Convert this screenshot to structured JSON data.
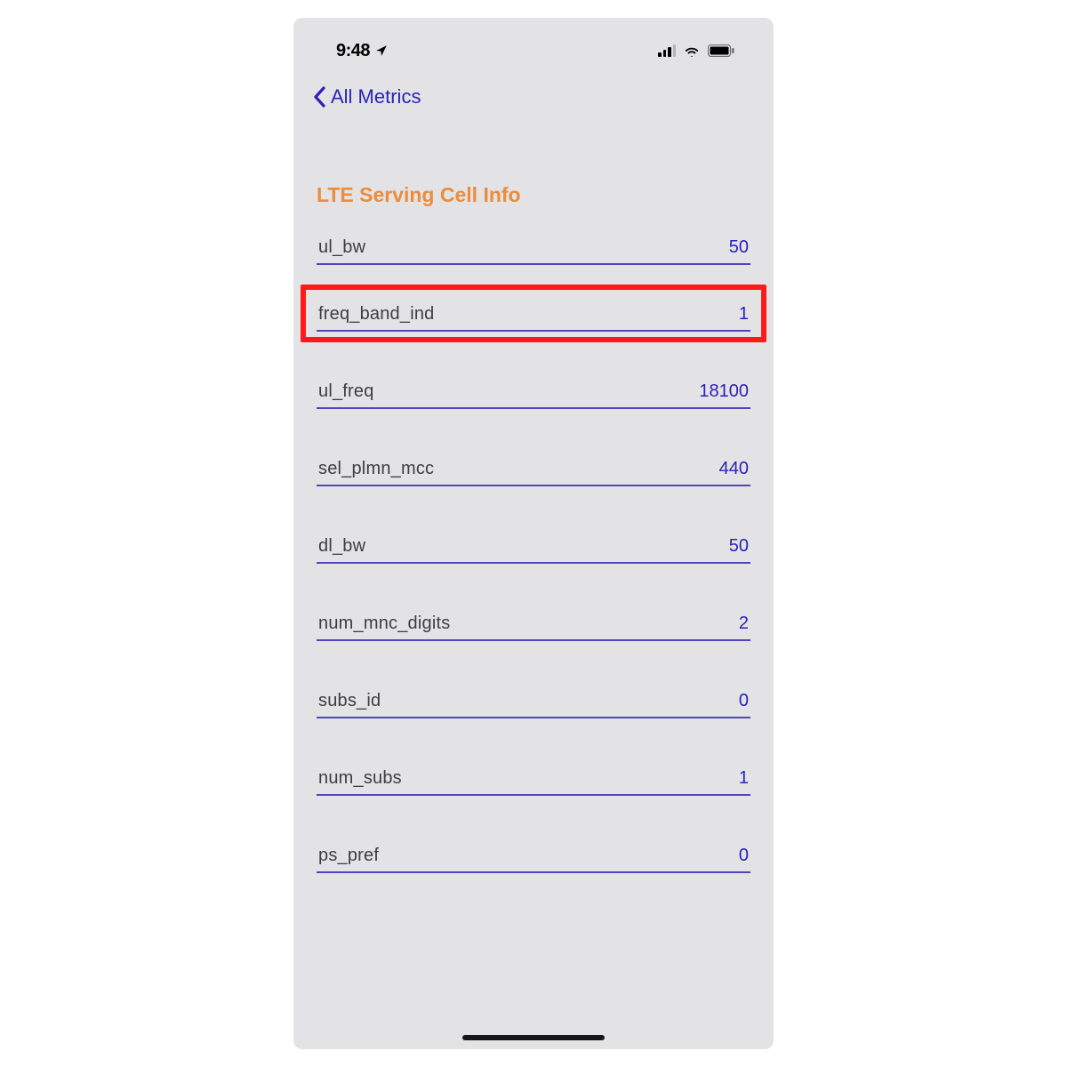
{
  "status": {
    "time": "9:48",
    "location_arrow": true
  },
  "nav": {
    "back_label": "All Metrics"
  },
  "section": {
    "title": "LTE Serving Cell Info"
  },
  "metrics": [
    {
      "label": "ul_bw",
      "value": "50",
      "highlighted": false
    },
    {
      "label": "freq_band_ind",
      "value": "1",
      "highlighted": true
    },
    {
      "label": "ul_freq",
      "value": "18100",
      "highlighted": false
    },
    {
      "label": "sel_plmn_mcc",
      "value": "440",
      "highlighted": false
    },
    {
      "label": "dl_bw",
      "value": "50",
      "highlighted": false
    },
    {
      "label": "num_mnc_digits",
      "value": "2",
      "highlighted": false
    },
    {
      "label": "subs_id",
      "value": "0",
      "highlighted": false
    },
    {
      "label": "num_subs",
      "value": "1",
      "highlighted": false
    },
    {
      "label": "ps_pref",
      "value": "0",
      "highlighted": false
    }
  ],
  "icons": {
    "back_chevron": "chevron-left",
    "location": "location-arrow",
    "cellular": "cellular-signal",
    "wifi": "wifi",
    "battery": "battery-full"
  }
}
